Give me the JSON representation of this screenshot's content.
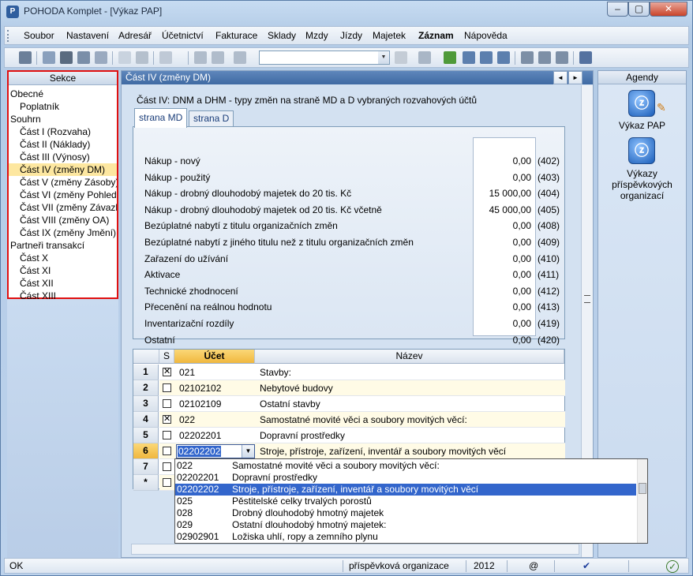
{
  "window": {
    "title": "POHODA Komplet - [Výkaz PAP]",
    "minimize": "–",
    "maximize": "▢",
    "close": "✕"
  },
  "menu": [
    "Soubor",
    "Nastavení",
    "Adresář",
    "Účetnictví",
    "Fakturace",
    "Sklady",
    "Mzdy",
    "Jízdy",
    "Majetek",
    "Záznam",
    "Nápověda"
  ],
  "sections": {
    "header": "Sekce",
    "items": [
      {
        "label": "Obecné",
        "level": 0
      },
      {
        "label": "Poplatník",
        "level": 1
      },
      {
        "label": "Souhrn",
        "level": 0
      },
      {
        "label": "Část I (Rozvaha)",
        "level": 1
      },
      {
        "label": "Část II (Náklady)",
        "level": 1
      },
      {
        "label": "Část III (Výnosy)",
        "level": 1
      },
      {
        "label": "Část IV (změny DM)",
        "level": 1,
        "selected": true
      },
      {
        "label": "Část V (změny Zásoby)",
        "level": 1
      },
      {
        "label": "Část VI (změny Pohledávk",
        "level": 1
      },
      {
        "label": "Část VII (změny Závazky)",
        "level": 1
      },
      {
        "label": "Část VIII (změny OA)",
        "level": 1
      },
      {
        "label": "Část IX (změny Jmění)",
        "level": 1
      },
      {
        "label": "Partneři transakcí",
        "level": 0
      },
      {
        "label": "Část X",
        "level": 1
      },
      {
        "label": "Část XI",
        "level": 1
      },
      {
        "label": "Část XII",
        "level": 1
      },
      {
        "label": "Část XIII",
        "level": 1
      }
    ]
  },
  "main": {
    "header": "Část IV (změny DM)",
    "nav_prev": "◄",
    "nav_next": "►",
    "group_title": "Část IV: DNM a DHM - typy změn na straně MD a D vybraných rozvahových účtů",
    "tabs": [
      {
        "label": "strana MD",
        "active": true
      },
      {
        "label": "strana D",
        "active": false
      }
    ],
    "fields": [
      {
        "label": "Nákup - nový",
        "value": "0,00",
        "code": "(402)"
      },
      {
        "label": "Nákup - použitý",
        "value": "0,00",
        "code": "(403)"
      },
      {
        "label": "Nákup - drobný dlouhodobý majetek do 20 tis. Kč",
        "value": "15 000,00",
        "code": "(404)"
      },
      {
        "label": "Nákup - drobný dlouhodobý majetek od 20 tis. Kč včetně",
        "value": "45 000,00",
        "code": "(405)"
      },
      {
        "label": "Bezúplatné nabytí z titulu organizačních změn",
        "value": "0,00",
        "code": "(408)"
      },
      {
        "label": "Bezúplatné nabytí z jiného titulu než z titulu organizačních změn",
        "value": "0,00",
        "code": "(409)"
      },
      {
        "label": "Zařazení do užívání",
        "value": "0,00",
        "code": "(410)"
      },
      {
        "label": "Aktivace",
        "value": "0,00",
        "code": "(411)"
      },
      {
        "label": "Technické zhodnocení",
        "value": "0,00",
        "code": "(412)"
      },
      {
        "label": "Přecenění na reálnou hodnotu",
        "value": "0,00",
        "code": "(413)"
      },
      {
        "label": "Inventarizační rozdíly",
        "value": "0,00",
        "code": "(419)"
      },
      {
        "label": "Ostatní",
        "value": "0,00",
        "code": "(420)"
      }
    ],
    "grid": {
      "columns": {
        "s": "S",
        "ucet": "Účet",
        "nazev": "Název"
      },
      "rows": [
        {
          "num": "1",
          "checked": true,
          "ucet": "021",
          "nazev": "Stavby:"
        },
        {
          "num": "2",
          "checked": false,
          "ucet": "02102102",
          "nazev": "Nebytové budovy"
        },
        {
          "num": "3",
          "checked": false,
          "ucet": "02102109",
          "nazev": "Ostatní stavby"
        },
        {
          "num": "4",
          "checked": true,
          "ucet": "022",
          "nazev": "Samostatné movité věci a soubory movitých věcí:"
        },
        {
          "num": "5",
          "checked": false,
          "ucet": "02202201",
          "nazev": "Dopravní prostředky"
        },
        {
          "num": "6",
          "checked": false,
          "ucet": "02202202",
          "nazev": "Stroje, přístroje, zařízení, inventář a soubory movitých věcí",
          "current": true
        },
        {
          "num": "7",
          "checked": false,
          "ucet": "",
          "nazev": ""
        },
        {
          "num": "*",
          "checked": false,
          "ucet": "",
          "nazev": ""
        }
      ]
    },
    "dropdown": [
      {
        "code": "022",
        "name": "Samostatné movité věci a soubory movitých věcí:"
      },
      {
        "code": "02202201",
        "name": "Dopravní prostředky"
      },
      {
        "code": "02202202",
        "name": "Stroje, přístroje, zařízení, inventář a soubory movitých věcí",
        "selected": true
      },
      {
        "code": "025",
        "name": "Pěstitelské celky trvalých porostů"
      },
      {
        "code": "028",
        "name": "Drobný dlouhodobý hmotný majetek"
      },
      {
        "code": "029",
        "name": "Ostatní dlouhodobý hmotný majetek:"
      },
      {
        "code": "02902901",
        "name": "Ložiska uhlí, ropy a zemního plynu"
      }
    ]
  },
  "agendy": {
    "header": "Agendy",
    "items": [
      {
        "label": "Výkaz PAP"
      },
      {
        "label": "Výkazy příspěvkových organizací"
      }
    ]
  },
  "status": {
    "left": "OK",
    "org": "příspěvková organizace",
    "year": "2012",
    "at": "@",
    "check": "✔",
    "ok_icon": "✓"
  }
}
